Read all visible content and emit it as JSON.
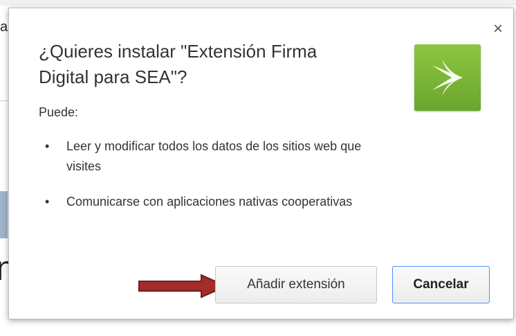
{
  "background": {
    "edge_char": "a",
    "big_letter": "n"
  },
  "dialog": {
    "title": "¿Quieres instalar \"Extensión Firma Digital para SEA\"?",
    "close_symbol": "×",
    "permissions_heading": "Puede:",
    "permissions": [
      "Leer y modificar todos los datos de los sitios web que visites",
      "Comunicarse con aplicaciones nativas cooperativas"
    ],
    "bullet": "•",
    "add_button_label": "Añadir extensión",
    "cancel_button_label": "Cancelar",
    "icon": "extension-logo-icon",
    "icon_color": "#7ab83a",
    "annotation_arrow_color": "#a32c2a"
  }
}
